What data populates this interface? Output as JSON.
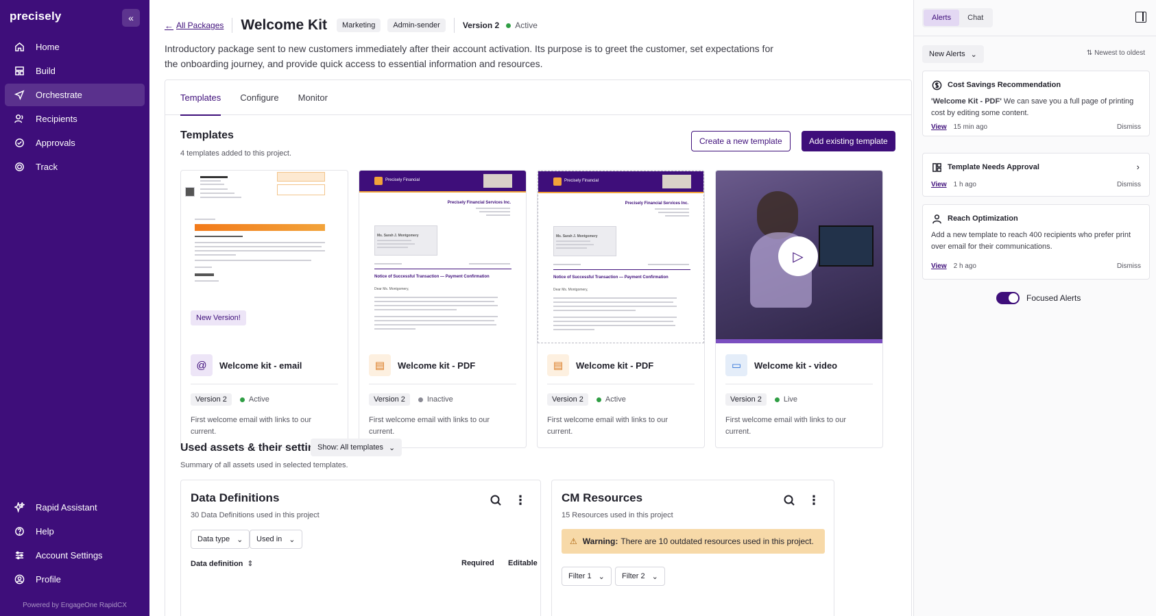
{
  "brand": "precisely",
  "sidebar": {
    "collapse_label": "«",
    "items": [
      {
        "label": "Home",
        "icon": "home-icon"
      },
      {
        "label": "Build",
        "icon": "build-icon"
      },
      {
        "label": "Orchestrate",
        "icon": "send-icon",
        "active": true
      },
      {
        "label": "Recipients",
        "icon": "users-icon"
      },
      {
        "label": "Approvals",
        "icon": "check-circle-icon"
      },
      {
        "label": "Track",
        "icon": "target-icon"
      }
    ],
    "bottom_items": [
      {
        "label": "Rapid Assistant",
        "icon": "sparkle-icon"
      },
      {
        "label": "Help",
        "icon": "help-icon"
      },
      {
        "label": "Account Settings",
        "icon": "sliders-icon"
      },
      {
        "label": "Profile",
        "icon": "profile-icon"
      }
    ],
    "powered_by": "Powered by EngageOne RapidCX"
  },
  "header": {
    "back_label": "All Packages",
    "title": "Welcome Kit",
    "tags": [
      "Marketing",
      "Admin-sender"
    ],
    "version": "Version 2",
    "status": "Active",
    "description": "Introductory package sent to new customers immediately after their account activation. Its purpose is to greet the customer, set expectations for the onboarding journey, and provide quick access to essential information and resources."
  },
  "tabs": [
    "Templates",
    "Configure",
    "Monitor"
  ],
  "templates": {
    "title": "Templates",
    "subtitle": "4 templates added to this project.",
    "create_label": "Create a new template",
    "add_label": "Add existing template",
    "new_version_badge": "New Version!",
    "cards": [
      {
        "name": "Welcome kit - email",
        "type": "email",
        "version": "Version 2",
        "status": "Active",
        "status_color": "#2f9e44",
        "description": "First welcome email with links to our current."
      },
      {
        "name": "Welcome kit - PDF",
        "type": "pdf",
        "version": "Version 2",
        "status": "Inactive",
        "status_color": "#8a8a94",
        "description": "First welcome email with links to our current."
      },
      {
        "name": "Welcome kit - PDF",
        "type": "pdf",
        "version": "Version 2",
        "status": "Active",
        "status_color": "#2f9e44",
        "description": "First welcome email with links to our current."
      },
      {
        "name": "Welcome kit - video",
        "type": "video",
        "version": "Version 2",
        "status": "Live",
        "status_color": "#2f9e44",
        "description": "First welcome email with links to our current."
      }
    ],
    "letter": {
      "company": "Precisely Financial",
      "sender": "Precisely Financial Services Inc.",
      "recipient": "Ms. Sarah J. Montgomery",
      "subject": "Notice of Successful Transaction — Payment Confirmation",
      "greeting": "Dear Ms. Montgomery,"
    }
  },
  "assets": {
    "title": "Used assets & their settings",
    "show_label": "Show: All templates",
    "subtitle": "Summary of all assets used in selected templates.",
    "data_definitions": {
      "title": "Data Definitions",
      "subtitle": "30 Data Definitions used in this project",
      "filters": [
        "Data type",
        "Used in"
      ],
      "columns": [
        "Data definition",
        "Required",
        "Editable"
      ]
    },
    "cm_resources": {
      "title": "CM Resources",
      "subtitle": "15 Resources used in this project",
      "warning_label": "Warning:",
      "warning_text": "There are 10 outdated resources used in this project.",
      "filters": [
        "Filter 1",
        "Filter 2"
      ]
    }
  },
  "alerts_panel": {
    "tabs": [
      "Alerts",
      "Chat"
    ],
    "filter_label": "New Alerts",
    "sort_label": "Newest to oldest",
    "view_label": "View",
    "dismiss_label": "Dismiss",
    "alerts": [
      {
        "title": "Cost Savings Recommendation",
        "icon": "dollar-icon",
        "bold": "'Welcome Kit - PDF'",
        "body": "We can save you a full page of printing cost by editing some content.",
        "time": "15 min ago"
      },
      {
        "title": "Template Needs Approval",
        "icon": "layout-icon",
        "time": "1 h ago"
      },
      {
        "title": "Reach Optimization",
        "icon": "user-icon",
        "body": "Add a new template to reach 400 recipients who prefer print over email for their communications.",
        "time": "2 h ago"
      }
    ],
    "focused_label": "Focused Alerts"
  }
}
